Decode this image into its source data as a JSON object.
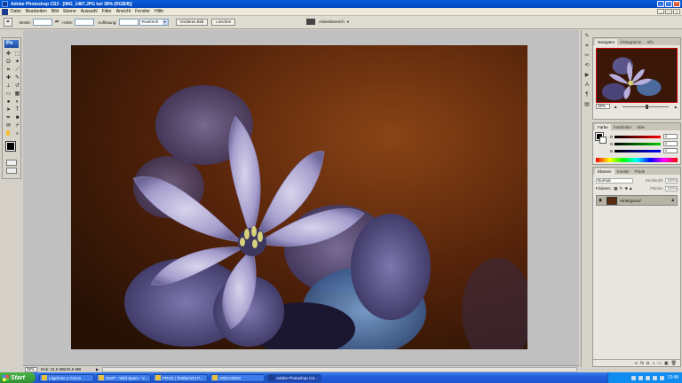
{
  "window": {
    "title": "Adobe Photoshop CS3 - [IMG_1487.JPG bei 38% (RGB/8)]"
  },
  "menu": [
    "Datei",
    "Bearbeiten",
    "Bild",
    "Ebene",
    "Auswahl",
    "Filter",
    "Ansicht",
    "Fenster",
    "Hilfe"
  ],
  "options": {
    "width_label": "Breite:",
    "height_label": "Höhe:",
    "resolution_label": "Auflösung:",
    "unit_value": "Pixel/Zoll",
    "front_image_btn": "Vorderes Bild",
    "delete_btn": "Löschen",
    "workspace_label": "Arbeitsbereich"
  },
  "status": {
    "zoom": "38%",
    "doc_info": "Dok: 34,6 MB/34,6 MB"
  },
  "navigator": {
    "tabs": [
      "Navigator",
      "Histogramm",
      "Info"
    ],
    "zoom": "38%"
  },
  "color_panel": {
    "tabs": [
      "Farbe",
      "Farbfelder",
      "Stile"
    ],
    "channels": [
      {
        "ch": "R",
        "value": "0",
        "color": "#e02020"
      },
      {
        "ch": "G",
        "value": "0",
        "color": "#20a020"
      },
      {
        "ch": "B",
        "value": "0",
        "color": "#2040e0"
      }
    ]
  },
  "layers": {
    "tabs": [
      "Ebenen",
      "Kanäle",
      "Pfade"
    ],
    "blend_mode": "Normal",
    "opacity_label": "Deckkraft:",
    "opacity": "100%",
    "lock_label": "Fixieren:",
    "fill_label": "Fläche:",
    "fill": "100%",
    "layer_name": "Hintergrund"
  },
  "taskbar": {
    "start": "Start",
    "tasks": [
      {
        "label": "Lágrimas y Gozos",
        "active": false
      },
      {
        "label": "StarP - Wild Spam - V...",
        "active": false
      },
      {
        "label": "PRAD | Testbericht P...",
        "active": false
      },
      {
        "label": "100CANON",
        "active": false
      },
      {
        "label": "Adobe Photoshop CS...",
        "active": true
      }
    ],
    "clock": "13:48"
  }
}
